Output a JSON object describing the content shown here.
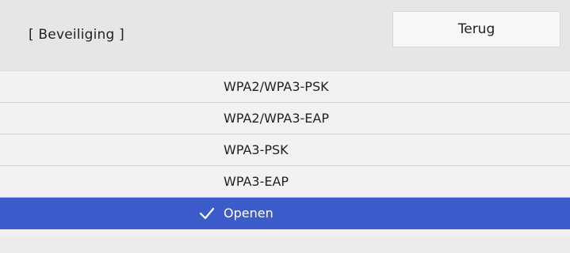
{
  "header": {
    "title": "[ Beveiliging ]",
    "back_label": "Terug"
  },
  "options": [
    {
      "label": "WPA2/WPA3-PSK",
      "selected": false
    },
    {
      "label": "WPA2/WPA3-EAP",
      "selected": false
    },
    {
      "label": "WPA3-PSK",
      "selected": false
    },
    {
      "label": "WPA3-EAP",
      "selected": false
    },
    {
      "label": "Openen",
      "selected": true
    }
  ],
  "colors": {
    "selected_background": "#3d5ccb",
    "header_background": "#e6e6e6",
    "list_background": "#f2f2f2"
  },
  "icons": {
    "selected_marker": "checkmark-icon"
  }
}
